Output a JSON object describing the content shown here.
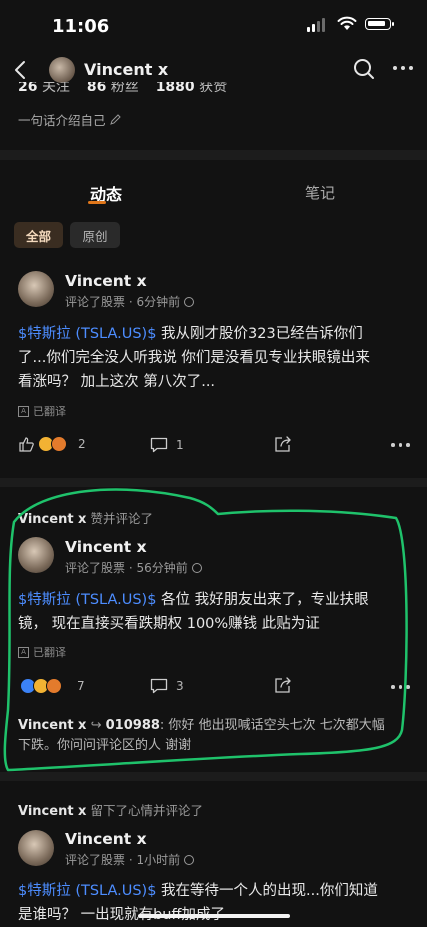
{
  "status": {
    "time": "11:06"
  },
  "nav": {
    "name": "Vincent x"
  },
  "profile": {
    "stats": [
      {
        "value": "26",
        "label": "关注"
      },
      {
        "value": "86",
        "label": "粉丝"
      },
      {
        "value": "1880",
        "label": "获赞"
      }
    ],
    "bio": "一句话介绍自己"
  },
  "tabs": {
    "active": "动态",
    "other": "笔记"
  },
  "filters": {
    "all": "全部",
    "original": "原创"
  },
  "posts": [
    {
      "author": "Vincent x",
      "meta": "评论了股票 · 6分钟前",
      "ticker": "$特斯拉 (TSLA.US)$",
      "text_line1": " 我从刚才股价323已经告诉你们",
      "text_line2": "了...你们完全没人听我说 你们是没看见专业扶眼镜出来",
      "text_line3": "看涨吗？ 加上这次 第八次了...",
      "translated": "已翻译",
      "reactions": "2",
      "comments": "1"
    },
    {
      "actor_name": "Vincent x",
      "actor_action": "赞并评论了",
      "author": "Vincent x",
      "meta": "评论了股票 · 56分钟前",
      "ticker": "$特斯拉 (TSLA.US)$",
      "text_line1": " 各位 我好朋友出来了，专业扶眼",
      "text_line2": "镜， 现在直接买看跌期权 100%赚钱 此贴为证",
      "translated": "已翻译",
      "reactions": "7",
      "comments": "3",
      "reply_from": "Vincent x",
      "reply_to": "010988",
      "reply_line1": ": 你好 他出现喊话空头七次 七次都大幅",
      "reply_line2": "下跌。你问问评论区的人 谢谢"
    },
    {
      "actor_name": "Vincent x",
      "actor_action": "留下了心情并评论了",
      "author": "Vincent x",
      "meta": "评论了股票 · 1小时前",
      "ticker": "$特斯拉 (TSLA.US)$",
      "text_line1": " 我在等待一个人的出现...你们知道",
      "text_line2": "是谁吗？ 一出现就有buff加成了"
    }
  ],
  "colors": {
    "accent": "#e0771b",
    "link": "#4d8dff",
    "annotation": "#1fc26b",
    "background": "#121212"
  }
}
